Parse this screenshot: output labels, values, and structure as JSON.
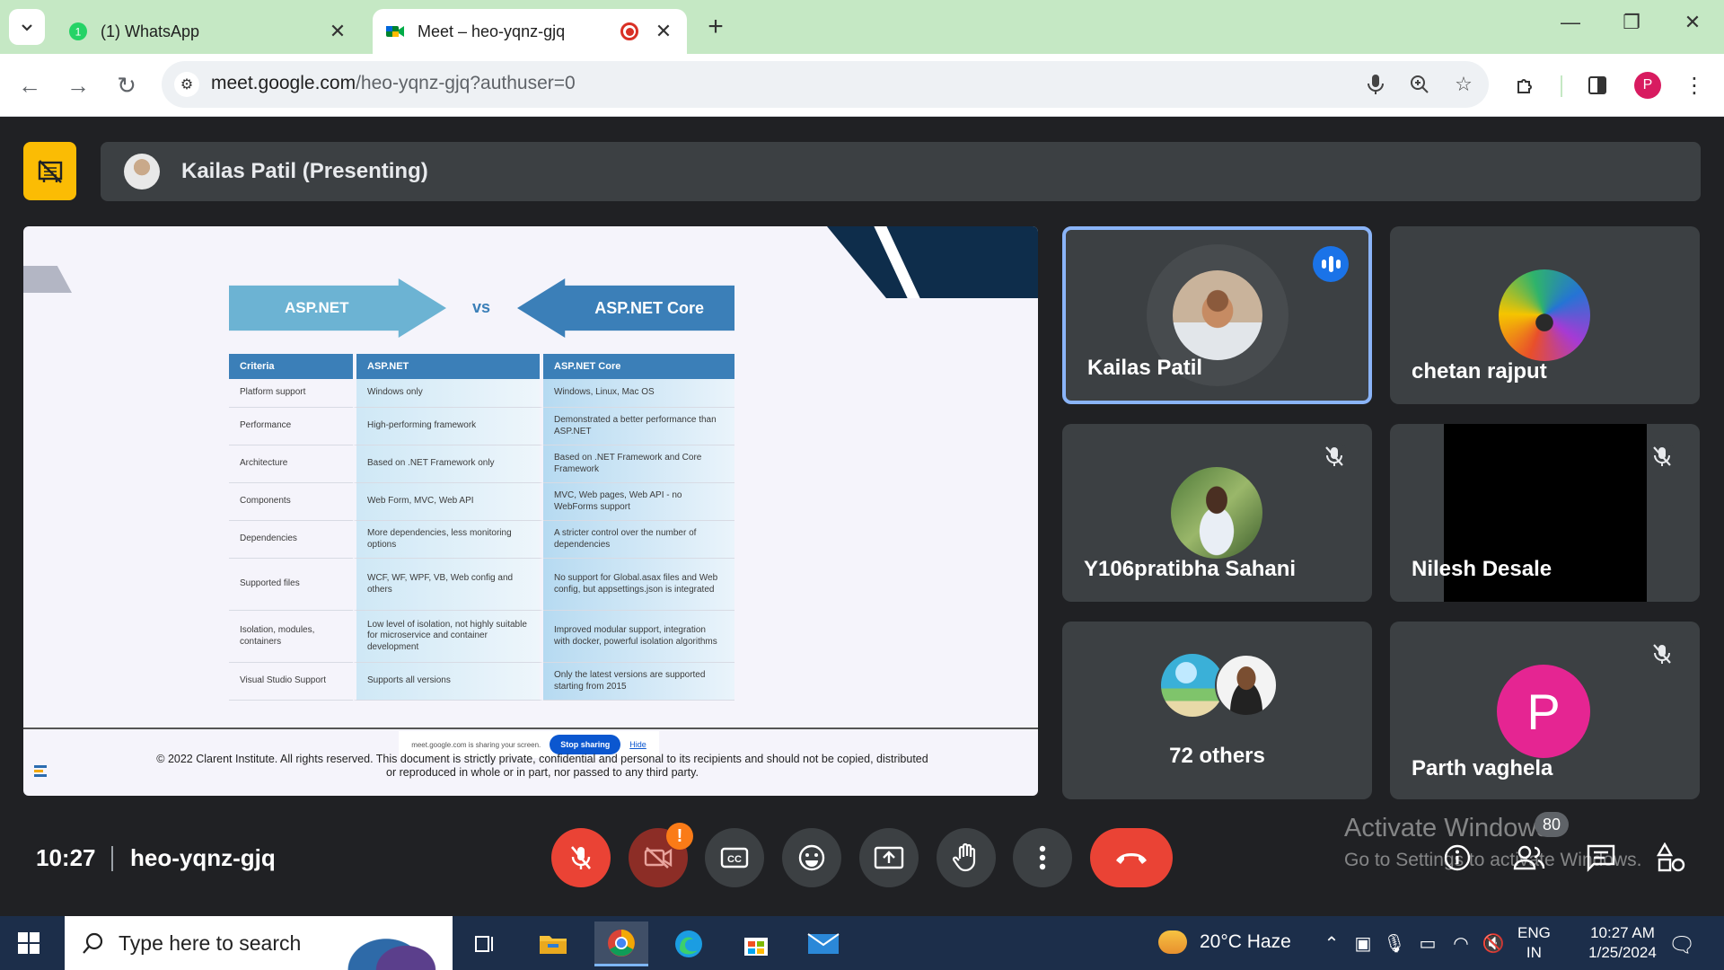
{
  "browser": {
    "tabs": [
      {
        "title": "(1) WhatsApp",
        "badge": "1",
        "active": false
      },
      {
        "title": "Meet – heo-yqnz-gjq",
        "active": true,
        "recording": true
      }
    ],
    "url_host": "meet.google.com",
    "url_path": "/heo-yqnz-gjq?authuser=0",
    "profile_initial": "P",
    "tabstrip_color": "#c5e8c4"
  },
  "meeting": {
    "presenter_label": "Kailas Patil (Presenting)",
    "clock": "10:27",
    "code": "heo-yqnz-gjq",
    "participant_count": "80",
    "participants": [
      {
        "name": "Kailas Patil",
        "speaking": true,
        "muted": false
      },
      {
        "name": "chetan rajput",
        "speaking": false,
        "muted": false
      },
      {
        "name": "Y106pratibha Sahani",
        "speaking": false,
        "muted": true
      },
      {
        "name": "Nilesh Desale",
        "speaking": false,
        "muted": true
      },
      {
        "name": "72 others",
        "speaking": false,
        "muted": false
      },
      {
        "name": "Parth vaghela",
        "speaking": false,
        "muted": true,
        "initial": "P"
      }
    ],
    "accent": "#ea4335"
  },
  "slide": {
    "left_arrow": "ASP.NET",
    "vs": "vs",
    "right_arrow": "ASP.NET Core",
    "table": {
      "headers": [
        "Criteria",
        "ASP.NET",
        "ASP.NET Core"
      ],
      "rows": [
        [
          "Platform support",
          "Windows only",
          "Windows, Linux, Mac OS"
        ],
        [
          "Performance",
          "High-performing framework",
          "Demonstrated a better performance than ASP.NET"
        ],
        [
          "Architecture",
          "Based on .NET Framework only",
          "Based on .NET Framework and Core Framework"
        ],
        [
          "Components",
          "Web Form, MVC, Web API",
          "MVC, Web pages, Web API - no WebForms support"
        ],
        [
          "Dependencies",
          "More dependencies, less monitoring options",
          "A stricter control over the number of dependencies"
        ],
        [
          "Supported files",
          "WCF, WF, WPF, VB, Web config and others",
          "No support for Global.asax files and Web config, but appsettings.json is integrated"
        ],
        [
          "Isolation, modules, containers",
          "Low level of isolation, not highly suitable for microservice and container development",
          "Improved modular support, integration with docker, powerful isolation algorithms"
        ],
        [
          "Visual Studio Support",
          "Supports all versions",
          "Only the latest versions are supported starting from 2015"
        ]
      ]
    },
    "share_notice": "meet.google.com is sharing your screen.",
    "stop_sharing": "Stop sharing",
    "hide": "Hide",
    "footer_line1": "© 2022 Clarent Institute. All rights reserved. This document is strictly private, confidential and personal to its recipients and should not be copied, distributed",
    "footer_line2": "or reproduced in whole or in part, nor passed to any third party."
  },
  "watermark": {
    "line1": "Activate Windows",
    "line2": "Go to Settings to activate Windows."
  },
  "taskbar": {
    "search_placeholder": "Type here to search",
    "weather": "20°C  Haze",
    "lang_top": "ENG",
    "lang_bottom": "IN",
    "time": "10:27 AM",
    "date": "1/25/2024"
  }
}
